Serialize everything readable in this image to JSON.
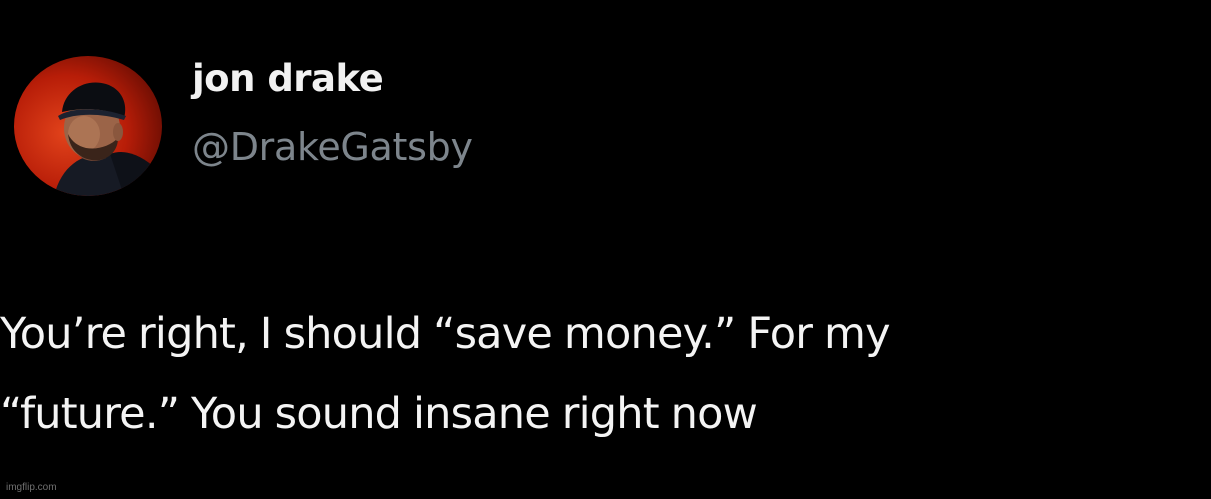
{
  "author": {
    "display_name": "jon drake",
    "handle": "@DrakeGatsby",
    "avatar_icon": "avatar-photo"
  },
  "tweet": {
    "lines": [
      "You’re right, I should “save money.” For my",
      "“future.” You sound insane right now"
    ]
  },
  "watermark": "imgflip.com",
  "colors": {
    "background": "#000000",
    "name_text": "#f2f2f2",
    "handle_text": "#7d858c",
    "body_text": "#f4f4f4",
    "avatar_bg": "#c0250a"
  }
}
